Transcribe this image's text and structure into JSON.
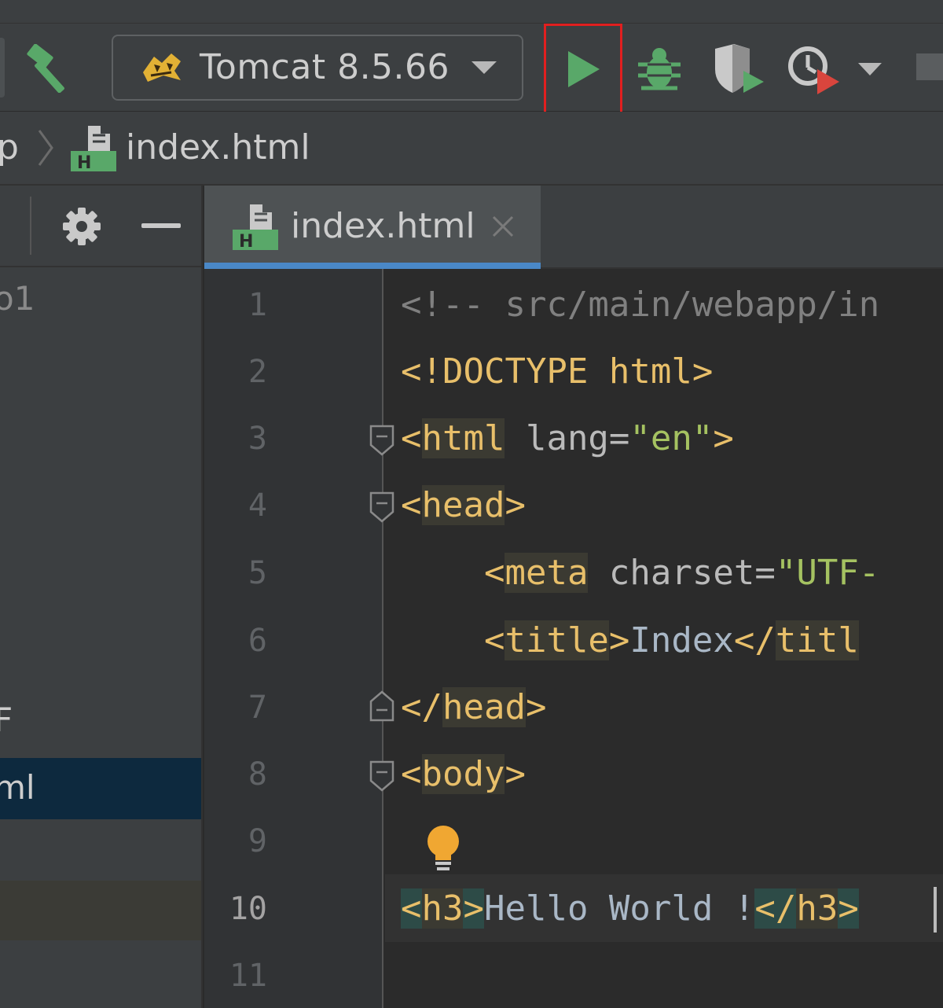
{
  "toolbar": {
    "run_config_label": "Tomcat 8.5.66"
  },
  "breadcrumb": {
    "prev_label": "p",
    "file_label": "index.html"
  },
  "project_panel": {
    "items": [
      {
        "label": "o1",
        "dim": true
      },
      {
        "label": "F",
        "dim": false
      },
      {
        "label": "ml",
        "dim": false
      }
    ]
  },
  "editor": {
    "tab_label": "index.html",
    "line_numbers": [
      "1",
      "2",
      "3",
      "4",
      "5",
      "6",
      "7",
      "8",
      "9",
      "10",
      "11"
    ],
    "current_line": "10",
    "code": {
      "l1": "<!-- src/main/webapp/in",
      "l2": "<!DOCTYPE html>",
      "l3_open": "<",
      "l3_tag": "html",
      "l3_attr": " lang=",
      "l3_val": "\"en\"",
      "l3_close": ">",
      "l4_open": "<",
      "l4_tag": "head",
      "l4_close": ">",
      "l5_open": "<",
      "l5_tag": "meta",
      "l5_attr": " charset=",
      "l5_val": "\"UTF-",
      "l6_open": "<",
      "l6_tag": "title",
      "l6_close": ">",
      "l6_text": "Index",
      "l6_end_open": "</",
      "l6_end_tag": "titl",
      "l7_open": "</",
      "l7_tag": "head",
      "l7_close": ">",
      "l8_open": "<",
      "l8_tag": "body",
      "l8_close": ">",
      "l10_open": "<",
      "l10_tag": "h3",
      "l10_close": ">",
      "l10_text": "Hello World !",
      "l10_end_open": "</",
      "l10_end_tag": "h3",
      "l10_end_close": ">"
    }
  },
  "colors": {
    "run_green": "#59a869",
    "highlight_red": "#e11f1f",
    "tab_underline": "#4a88c7",
    "tag_yellow": "#e8bf6a",
    "string_green": "#a5c261"
  },
  "icons": [
    "hammer-icon",
    "tomcat-icon",
    "chevron-down-icon",
    "run-icon",
    "debug-icon",
    "coverage-icon",
    "profile-icon",
    "gear-icon",
    "minimize-icon",
    "html-file-icon",
    "close-icon",
    "lightbulb-icon",
    "fold-icon"
  ]
}
